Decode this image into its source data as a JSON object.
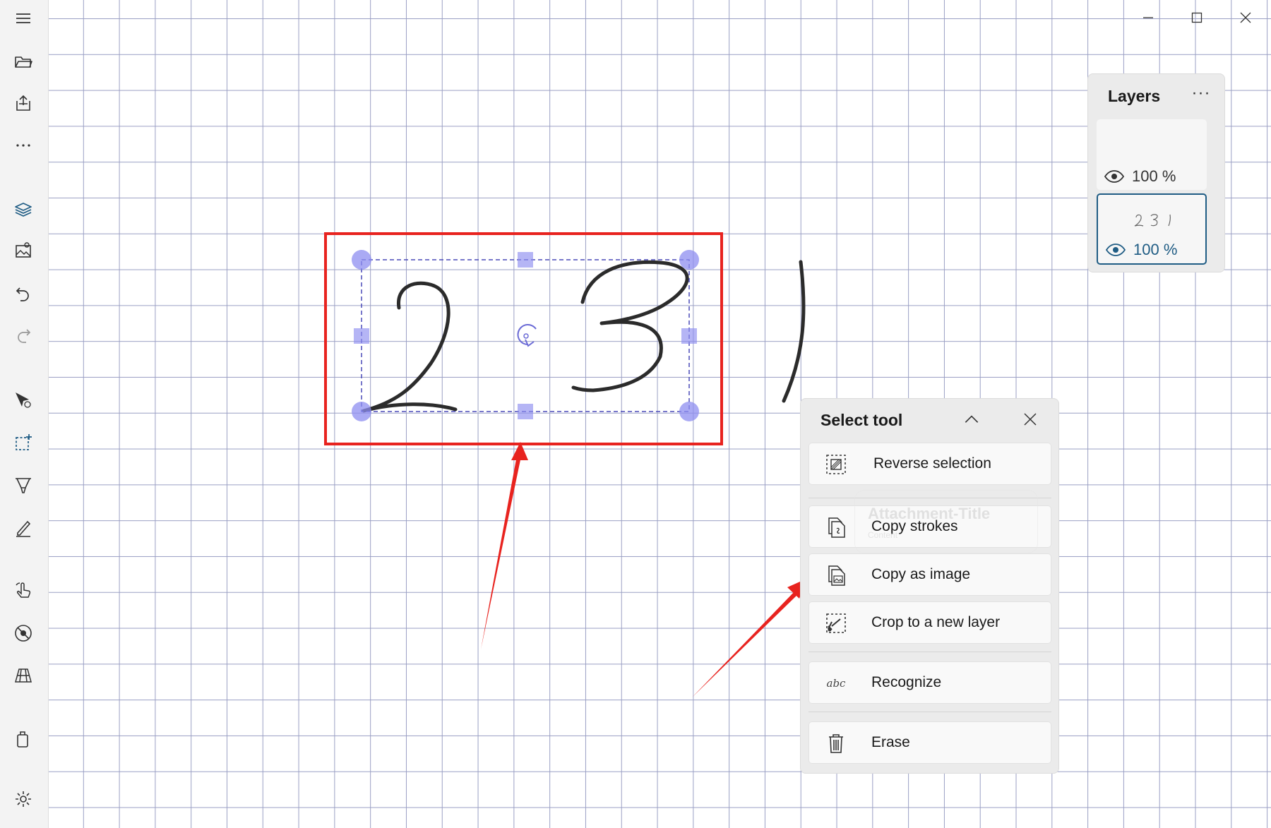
{
  "window": {
    "controls": [
      "minimize-icon",
      "maximize-icon",
      "close-icon"
    ]
  },
  "toolbar": {
    "items": [
      {
        "name": "menu-icon"
      },
      {
        "name": "open-folder-icon"
      },
      {
        "name": "export-icon"
      },
      {
        "name": "more-icon"
      },
      {
        "name": "layers-icon"
      },
      {
        "name": "insert-image-icon"
      },
      {
        "name": "undo-icon"
      },
      {
        "name": "redo-icon"
      },
      {
        "name": "select-move-icon"
      },
      {
        "name": "lasso-select-icon"
      },
      {
        "name": "highlighter-icon"
      },
      {
        "name": "pen-icon"
      },
      {
        "name": "touch-draw-icon"
      },
      {
        "name": "ruler-protractor-icon"
      },
      {
        "name": "grid-perspective-icon"
      },
      {
        "name": "clear-canvas-icon"
      },
      {
        "name": "settings-icon"
      }
    ]
  },
  "layers": {
    "title": "Layers",
    "more": "···",
    "items": [
      {
        "opacity": "100 %",
        "thumbnail": "",
        "selected": false
      },
      {
        "opacity": "100 %",
        "thumbnail": "2 3 1",
        "selected": true
      }
    ]
  },
  "select_tool": {
    "title": "Select tool",
    "items": [
      {
        "label": "Reverse selection",
        "icon": "reverse-selection-icon"
      },
      {
        "label": "Copy strokes",
        "icon": "copy-strokes-icon"
      },
      {
        "label": "Copy as image",
        "icon": "copy-as-image-icon"
      },
      {
        "label": "Crop to a new layer",
        "icon": "crop-layer-icon"
      },
      {
        "label": "Recognize",
        "icon": "recognize-icon",
        "icon_text": "abc"
      },
      {
        "label": "Erase",
        "icon": "trash-icon"
      }
    ]
  },
  "ghost_attachment": {
    "title": "Attachment-Title",
    "subtitle": "Content"
  },
  "canvas": {
    "handwriting": [
      "2",
      "3",
      "1"
    ],
    "colors": {
      "grid": "#9a9fc4",
      "ink": "#2b2b2b",
      "selection": "#6b6bd6",
      "highlight": "#e8231f",
      "accent": "#1f5c84"
    }
  }
}
